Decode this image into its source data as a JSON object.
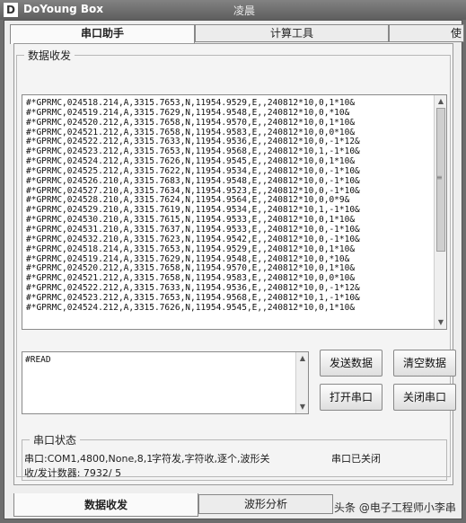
{
  "window": {
    "app_icon": "D",
    "app_name": "DoYoung Box",
    "title": "凌晨"
  },
  "top_tabs": [
    {
      "label": "串口助手"
    },
    {
      "label": "计算工具"
    },
    {
      "label": "使"
    }
  ],
  "receive": {
    "legend": "数据收发",
    "lines": [
      "#*GPRMC,024518.214,A,3315.7653,N,11954.9529,E,,240812*10,0,1*10&",
      "#*GPRMC,024519.214,A,3315.7629,N,11954.9548,E,,240812*10,0,*10&",
      "#*GPRMC,024520.212,A,3315.7658,N,11954.9570,E,,240812*10,0,1*10&",
      "#*GPRMC,024521.212,A,3315.7658,N,11954.9583,E,,240812*10,0,0*10&",
      "#*GPRMC,024522.212,A,3315.7633,N,11954.9536,E,,240812*10,0,-1*12&",
      "#*GPRMC,024523.212,A,3315.7653,N,11954.9568,E,,240812*10,1,-1*10&",
      "#*GPRMC,024524.212,A,3315.7626,N,11954.9545,E,,240812*10,0,1*10&",
      "#*GPRMC,024525.212,A,3315.7622,N,11954.9534,E,,240812*10,0,-1*10&",
      "#*GPRMC,024526.210,A,3315.7683,N,11954.9548,E,,240812*10,0,-1*10&",
      "#*GPRMC,024527.210,A,3315.7634,N,11954.9523,E,,240812*10,0,-1*10&",
      "#*GPRMC,024528.210,A,3315.7624,N,11954.9564,E,,240812*10,0,0*9&",
      "#*GPRMC,024529.210,A,3315.7619,N,11954.9534,E,,240812*10,1,-1*10&",
      "#*GPRMC,024530.210,A,3315.7615,N,11954.9533,E,,240812*10,0,1*10&",
      "#*GPRMC,024531.210,A,3315.7637,N,11954.9533,E,,240812*10,0,-1*10&",
      "#*GPRMC,024532.210,A,3315.7623,N,11954.9542,E,,240812*10,0,-1*10&",
      "#*GPRMC,024518.214,A,3315.7653,N,11954.9529,E,,240812*10,0,1*10&",
      "#*GPRMC,024519.214,A,3315.7629,N,11954.9548,E,,240812*10,0,*10&",
      "#*GPRMC,024520.212,A,3315.7658,N,11954.9570,E,,240812*10,0,1*10&",
      "#*GPRMC,024521.212,A,3315.7658,N,11954.9583,E,,240812*10,0,0*10&",
      "#*GPRMC,024522.212,A,3315.7633,N,11954.9536,E,,240812*10,0,-1*12&",
      "#*GPRMC,024523.212,A,3315.7653,N,11954.9568,E,,240812*10,1,-1*10&",
      "#*GPRMC,024524.212,A,3315.7626,N,11954.9545,E,,240812*10,0,1*10&"
    ]
  },
  "send": {
    "value": "#READ"
  },
  "buttons": {
    "send_data": "发送数据",
    "clear_data": "清空数据",
    "open_port": "打开串口",
    "close_port": "关闭串口"
  },
  "status": {
    "legend": "串口状态",
    "port_info": "串口:COM1,4800,None,8,1",
    "mode_info": "字符发,字符收,逐个,波形关",
    "port_state": "串口已关闭",
    "counter": "收/发计数器:  7932/  5"
  },
  "bottom_tabs": [
    {
      "label": "数据收发"
    },
    {
      "label": "波形分析"
    }
  ],
  "watermark": "头条 @电子工程师小李串",
  "icons": {
    "scroll_up": "scroll-up-icon",
    "scroll_down": "scroll-down-icon"
  }
}
